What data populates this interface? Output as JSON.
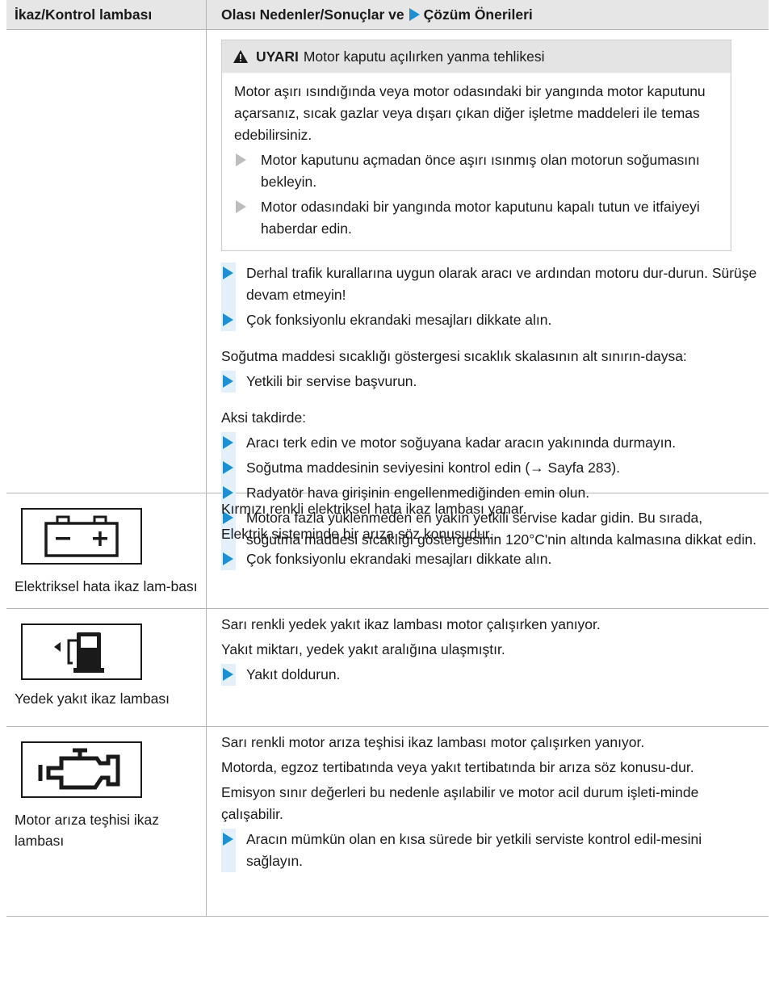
{
  "header": {
    "col_left": "İkaz/Kontrol lambası",
    "col_right_part1": "Olası Nedenler/Sonuçlar ve",
    "col_right_part2": "Çözüm Önerileri"
  },
  "row1": {
    "warning": {
      "label": "UYARI",
      "title": "Motor kaputu açılırken yanma tehlikesi",
      "body": "Motor aşırı ısındığında veya motor odasındaki bir yangında motor kaputunu açarsanız, sıcak gazlar veya dışarı çıkan diğer işletme maddeleri ile temas edebilirsiniz.",
      "items": [
        "Motor kaputunu açmadan önce aşırı ısınmış olan motorun soğumasını bekleyin.",
        "Motor odasındaki bir yangında motor kaputunu kapalı tutun ve itfaiyeyi haberdar edin."
      ]
    },
    "steps1": [
      "Derhal trafik kurallarına uygun olarak aracı ve ardından motoru dur-durun. Sürüşe devam etmeyin!",
      "Çok fonksiyonlu ekrandaki mesajları dikkate alın."
    ],
    "para2": "Soğutma maddesi sıcaklığı göstergesi sıcaklık skalasının alt sınırın-daysa:",
    "steps2": [
      "Yetkili bir servise başvurun."
    ],
    "para3": "Aksi takdirde:",
    "steps3": [
      "Aracı terk edin ve motor soğuyana kadar aracın yakınında durmayın.",
      "Soğutma maddesinin seviyesini kontrol edin (→ Sayfa 283).",
      "Radyatör hava girişinin engellenmediğinden emin olun.",
      "Motora fazla yüklenmeden en yakın yetkili servise kadar gidin. Bu sırada, soğutma maddesi sıcaklığı göstergesinin 120°C'nin altında kalmasına dikkat edin."
    ]
  },
  "row2": {
    "lamp_label": "Elektriksel hata ikaz lam-bası",
    "icon": "battery-icon",
    "lines": [
      "Kırmızı renkli elektriksel hata ikaz lambası yanar.",
      "Elektrik sisteminde bir arıza söz konusudur."
    ],
    "steps": [
      "Çok fonksiyonlu ekrandaki mesajları dikkate alın."
    ]
  },
  "row3": {
    "lamp_label": "Yedek yakıt ikaz lambası",
    "icon": "fuel-pump-icon",
    "lines": [
      "Sarı renkli yedek yakıt ikaz lambası motor çalışırken yanıyor.",
      "Yakıt miktarı, yedek yakıt aralığına ulaşmıştır."
    ],
    "steps": [
      "Yakıt doldurun."
    ]
  },
  "row4": {
    "lamp_label": "Motor arıza teşhisi ikaz lambası",
    "icon": "engine-check-icon",
    "lines": [
      "Sarı renkli motor arıza teşhisi ikaz lambası motor çalışırken yanıyor.",
      "Motorda, egzoz tertibatında veya yakıt tertibatında bir arıza söz konusu-dur.",
      "Emisyon sınır değerleri bu nedenle aşılabilir ve motor acil durum işleti-minde çalışabilir."
    ],
    "steps": [
      "Aracın mümkün olan en kısa sürede bir yetkili serviste kontrol edil-mesini sağlayın."
    ]
  },
  "colors": {
    "accent": "#1e8fd0",
    "header_bg": "#e6e6e6",
    "border": "#b5b5b5"
  }
}
